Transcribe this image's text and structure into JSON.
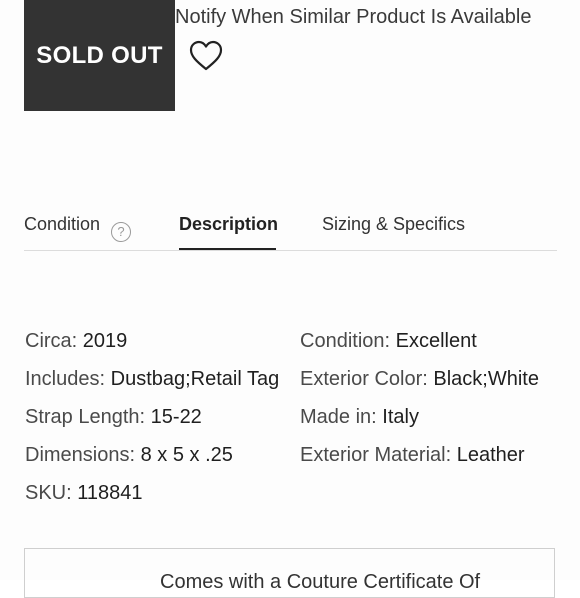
{
  "product": {
    "sold_out_label": "SOLD OUT",
    "notify_text": "Notify When Similar Product Is Available",
    "heart_icon": "heart-outline-icon"
  },
  "tabs": [
    {
      "label": "Condition",
      "help_icon": "question-circle-icon"
    },
    {
      "label": "Description",
      "active": true
    },
    {
      "label": "Sizing & Specifics"
    }
  ],
  "specs": {
    "circa": {
      "label": "Circa:",
      "value": "2019"
    },
    "condition": {
      "label": "Condition:",
      "value": "Excellent"
    },
    "includes": {
      "label": "Includes:",
      "value": "Dustbag;Retail Tag"
    },
    "exterior_color": {
      "label": "Exterior Color:",
      "value": "Black;White"
    },
    "strap_length": {
      "label": "Strap Length:",
      "value": "15-22"
    },
    "made_in": {
      "label": "Made in:",
      "value": "Italy"
    },
    "dimensions": {
      "label": "Dimensions:",
      "value": "8 x 5 x .25"
    },
    "exterior_material": {
      "label": "Exterior Material:",
      "value": "Leather"
    },
    "sku": {
      "label": "SKU:",
      "value": "118841"
    }
  },
  "certificate": {
    "text": "Comes with a Couture Certificate Of"
  },
  "colors": {
    "sold_out_bg": "#333333",
    "active_tab_underline": "#222222",
    "divider": "#dcdcdc"
  }
}
